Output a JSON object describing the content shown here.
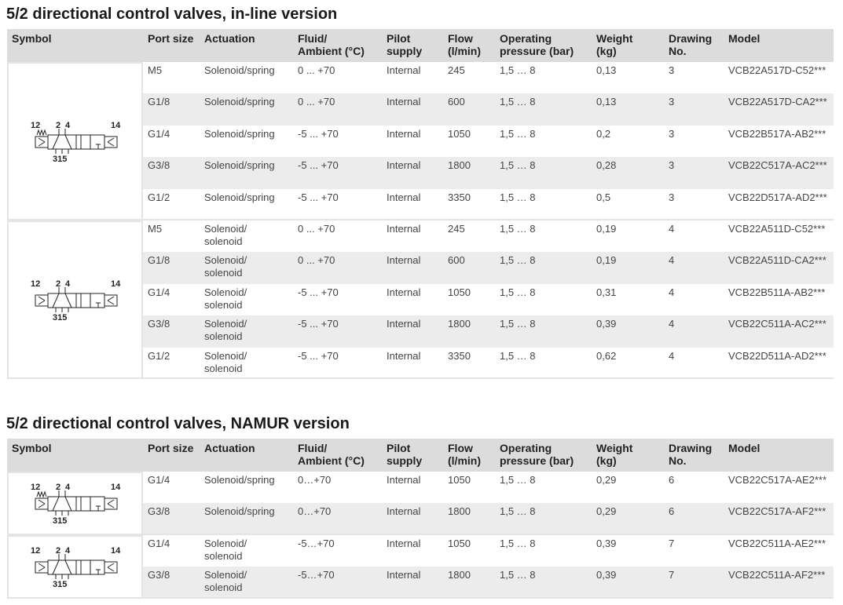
{
  "sections": [
    {
      "title": "5/2 directional control valves, in-line version",
      "groups": [
        {
          "symbol": {
            "ports_top_left": "12",
            "ports_top_mid": [
              "2",
              "4"
            ],
            "ports_top_right": "14",
            "ports_bottom": "315",
            "left_actuator": "spring"
          },
          "rows": [
            [
              "M5",
              "Solenoid/spring",
              "0 ... +70",
              "Internal",
              "245",
              "1,5 … 8",
              "0,13",
              "3",
              "VCB22A517D-C52***"
            ],
            [
              "G1/8",
              "Solenoid/spring",
              "0 ... +70",
              "Internal",
              "600",
              "1,5 … 8",
              "0,13",
              "3",
              "VCB22A517D-CA2***"
            ],
            [
              "G1/4",
              "Solenoid/spring",
              "-5 ... +70",
              "Internal",
              "1050",
              "1,5 … 8",
              "0,2",
              "3",
              "VCB22B517A-AB2***"
            ],
            [
              "G3/8",
              "Solenoid/spring",
              "-5 ... +70",
              "Internal",
              "1800",
              "1,5 … 8",
              "0,28",
              "3",
              "VCB22C517A-AC2***"
            ],
            [
              "G1/2",
              "Solenoid/spring",
              "-5 ... +70",
              "Internal",
              "3350",
              "1,5 … 8",
              "0,5",
              "3",
              "VCB22D517A-AD2***"
            ]
          ]
        },
        {
          "symbol": {
            "ports_top_left": "12",
            "ports_top_mid": [
              "2",
              "4"
            ],
            "ports_top_right": "14",
            "ports_bottom": "315",
            "left_actuator": "solenoid"
          },
          "rows": [
            [
              "M5",
              "Solenoid/\nsolenoid",
              "0 ... +70",
              "Internal",
              "245",
              "1,5 … 8",
              "0,19",
              "4",
              "VCB22A511D-C52***"
            ],
            [
              "G1/8",
              "Solenoid/\nsolenoid",
              "0 ... +70",
              "Internal",
              "600",
              "1,5 … 8",
              "0,19",
              "4",
              "VCB22A511D-CA2***"
            ],
            [
              "G1/4",
              "Solenoid/\nsolenoid",
              "-5 ... +70",
              "Internal",
              "1050",
              "1,5 … 8",
              "0,31",
              "4",
              "VCB22B511A-AB2***"
            ],
            [
              "G3/8",
              "Solenoid/\nsolenoid",
              "-5 ... +70",
              "Internal",
              "1800",
              "1,5 … 8",
              "0,39",
              "4",
              "VCB22C511A-AC2***"
            ],
            [
              "G1/2",
              "Solenoid/\nsolenoid",
              "-5 ... +70",
              "Internal",
              "3350",
              "1,5 … 8",
              "0,62",
              "4",
              "VCB22D511A-AD2***"
            ]
          ]
        }
      ]
    },
    {
      "title": "5/2 directional control valves, NAMUR version",
      "groups": [
        {
          "symbol": {
            "ports_top_left": "12",
            "ports_top_mid": [
              "2",
              "4"
            ],
            "ports_top_right": "14",
            "ports_bottom": "315",
            "left_actuator": "spring"
          },
          "rows": [
            [
              "G1/4",
              "Solenoid/spring",
              "0…+70",
              "Internal",
              "1050",
              "1,5 … 8",
              "0,29",
              "6",
              "VCB22C517A-AE2***"
            ],
            [
              "G3/8",
              "Solenoid/spring",
              "0…+70",
              "Internal",
              "1800",
              "1,5 … 8",
              "0,29",
              "6",
              "VCB22C517A-AF2***"
            ]
          ]
        },
        {
          "symbol": {
            "ports_top_left": "12",
            "ports_top_mid": [
              "2",
              "4"
            ],
            "ports_top_right": "14",
            "ports_bottom": "315",
            "left_actuator": "solenoid"
          },
          "rows": [
            [
              "G1/4",
              "Solenoid/\nsolenoid",
              "-5…+70",
              "Internal",
              "1050",
              "1,5 … 8",
              "0,39",
              "7",
              "VCB22C511A-AE2***"
            ],
            [
              "G3/8",
              "Solenoid/\nsolenoid",
              "-5…+70",
              "Internal",
              "1800",
              "1,5 … 8",
              "0,39",
              "7",
              "VCB22C511A-AF2***"
            ]
          ]
        }
      ]
    }
  ],
  "headers": {
    "symbol": "Symbol",
    "port_size": "Port size",
    "actuation": "Actuation",
    "fluid_ambient": "Fluid/\nAmbient (°C)",
    "pilot_supply": "Pilot\nsupply",
    "flow": "Flow\n(l/min)",
    "operating_pressure": "Operating\npressure (bar)",
    "weight": "Weight\n(kg)",
    "drawing_no": "Drawing\nNo.",
    "model": "Model"
  },
  "colors": {
    "header_bg": "#dcdcdc",
    "row_shade": "#ececec",
    "title": "#1a1a1a",
    "body_text": "#444444"
  }
}
